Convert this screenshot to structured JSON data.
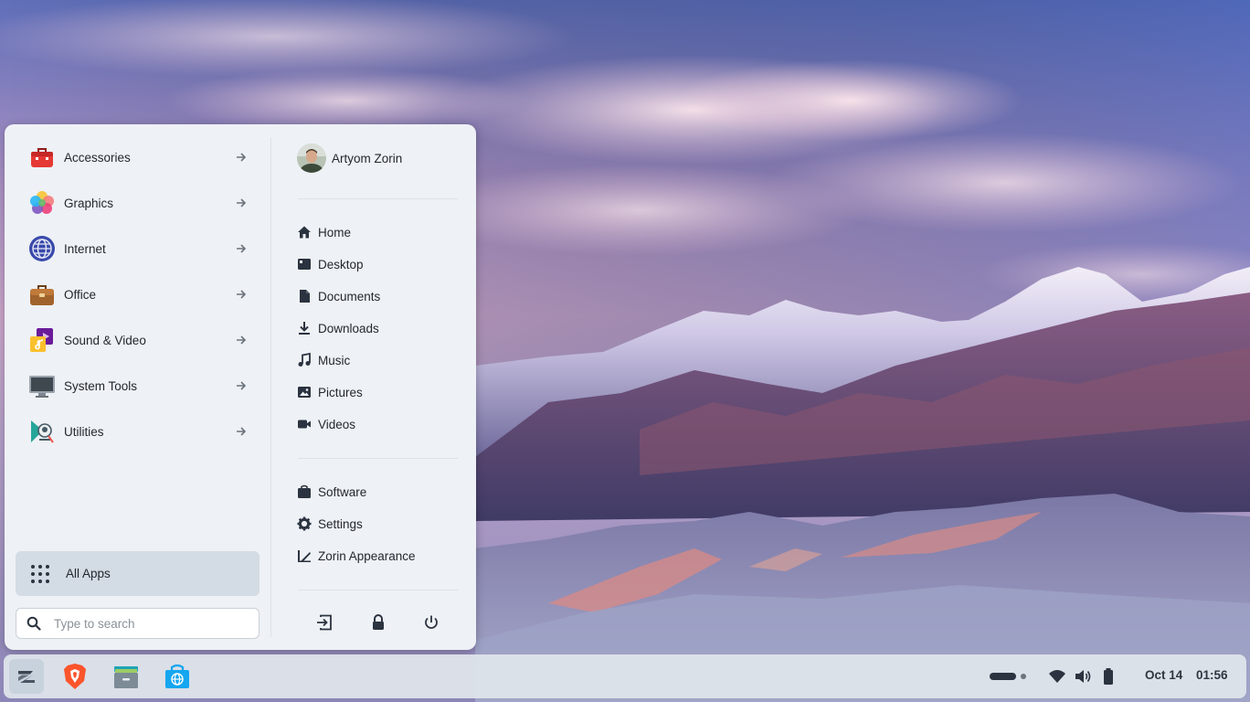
{
  "menu": {
    "categories": [
      {
        "label": "Accessories",
        "icon": "toolbox-icon"
      },
      {
        "label": "Graphics",
        "icon": "graphics-icon"
      },
      {
        "label": "Internet",
        "icon": "globe-icon"
      },
      {
        "label": "Office",
        "icon": "briefcase-icon"
      },
      {
        "label": "Sound & Video",
        "icon": "music-icon"
      },
      {
        "label": "System Tools",
        "icon": "monitor-icon"
      },
      {
        "label": "Utilities",
        "icon": "utilities-icon"
      }
    ],
    "all_apps_label": "All Apps",
    "search_placeholder": "Type to search",
    "user_name": "Artyom Zorin",
    "places": [
      {
        "label": "Home",
        "icon": "home-icon"
      },
      {
        "label": "Desktop",
        "icon": "desktop-icon"
      },
      {
        "label": "Documents",
        "icon": "document-icon"
      },
      {
        "label": "Downloads",
        "icon": "download-icon"
      },
      {
        "label": "Music",
        "icon": "music-note-icon"
      },
      {
        "label": "Pictures",
        "icon": "picture-icon"
      },
      {
        "label": "Videos",
        "icon": "video-icon"
      }
    ],
    "system": [
      {
        "label": "Software",
        "icon": "software-icon"
      },
      {
        "label": "Settings",
        "icon": "gear-icon"
      },
      {
        "label": "Zorin Appearance",
        "icon": "appearance-icon"
      }
    ]
  },
  "taskbar": {
    "apps": [
      "zorin-menu-icon",
      "brave-browser-icon",
      "files-icon",
      "software-store-icon"
    ],
    "date": "Oct 14",
    "time": "01:56"
  },
  "colors": {
    "menu_bg": "#eef1f5",
    "selected_bg": "#d3dbe4",
    "icon_dark": "#2b3340",
    "accent": "#15a6f0"
  }
}
